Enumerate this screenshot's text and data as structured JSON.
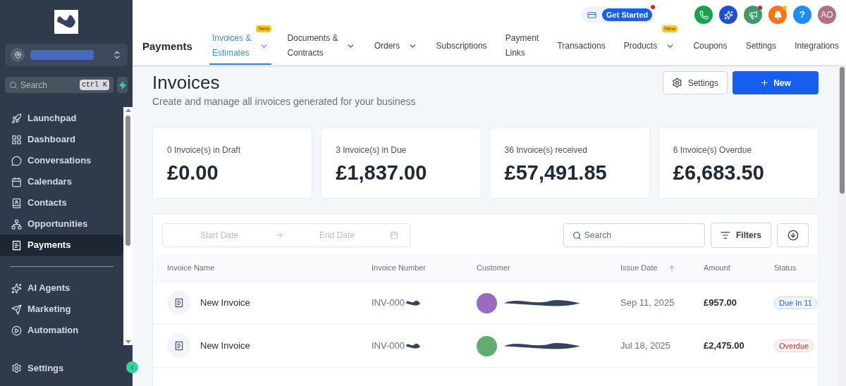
{
  "sidebar": {
    "search": {
      "placeholder": "Search",
      "shortcut": "ctrl K"
    },
    "items": [
      {
        "label": "Launchpad",
        "selected": false
      },
      {
        "label": "Dashboard",
        "selected": false
      },
      {
        "label": "Conversations",
        "selected": false
      },
      {
        "label": "Calendars",
        "selected": false
      },
      {
        "label": "Contacts",
        "selected": false
      },
      {
        "label": "Opportunities",
        "selected": false
      },
      {
        "label": "Payments",
        "selected": true
      }
    ],
    "items_2": [
      {
        "label": "AI Agents",
        "selected": false
      },
      {
        "label": "Marketing",
        "selected": false
      },
      {
        "label": "Automation",
        "selected": false
      }
    ],
    "footer": {
      "label": "Settings"
    }
  },
  "topbar": {
    "get_started": "Get Started",
    "help": "?",
    "avatar": "AO"
  },
  "header": {
    "title": "Payments",
    "tabs": [
      {
        "label": "Invoices &\nEstimates",
        "selected": true,
        "badge": "New",
        "dropdown": true
      },
      {
        "label": "Documents &\nContracts",
        "selected": false,
        "dropdown": true
      },
      {
        "label": "Orders",
        "selected": false,
        "dropdown": true
      },
      {
        "label": "Subscriptions",
        "selected": false,
        "dropdown": false
      },
      {
        "label": "Payment\nLinks",
        "selected": false,
        "dropdown": false
      },
      {
        "label": "Transactions",
        "selected": false,
        "dropdown": false
      },
      {
        "label": "Products",
        "selected": false,
        "badge": "New",
        "dropdown": true
      },
      {
        "label": "Coupons",
        "selected": false,
        "dropdown": false
      },
      {
        "label": "Settings",
        "selected": false,
        "dropdown": false
      },
      {
        "label": "Integrations",
        "selected": false,
        "dropdown": false
      }
    ]
  },
  "page": {
    "title": "Invoices",
    "subtitle": "Create and manage all invoices generated for your business",
    "settings_button": "Settings",
    "new_button": "New"
  },
  "stats": [
    {
      "label": "0 Invoice(s) in Draft",
      "value": "£0.00"
    },
    {
      "label": "3 Invoice(s) in Due",
      "value": "£1,837.00"
    },
    {
      "label": "36 Invoice(s) received",
      "value": "£57,491.85"
    },
    {
      "label": "6 Invoice(s) Overdue",
      "value": "£6,683.50"
    }
  ],
  "filters": {
    "start_date": "Start Date",
    "end_date": "End Date",
    "search_placeholder": "Search",
    "filters_button": "Filters"
  },
  "table": {
    "columns": [
      "Invoice Name",
      "Invoice Number",
      "Customer",
      "Issue Date",
      "Amount",
      "Status"
    ],
    "rows": [
      {
        "name": "New Invoice",
        "number": "INV-000",
        "color": "#9b6bc0",
        "issue_date": "Sep 11, 2025",
        "amount": "£957.00",
        "status": "Due In 11",
        "kind": "due"
      },
      {
        "name": "New Invoice",
        "number": "INV-000",
        "color": "#5fae6e",
        "issue_date": "Jul 18, 2025",
        "amount": "£2,475.00",
        "status": "Overdue",
        "kind": "overdue"
      }
    ]
  }
}
